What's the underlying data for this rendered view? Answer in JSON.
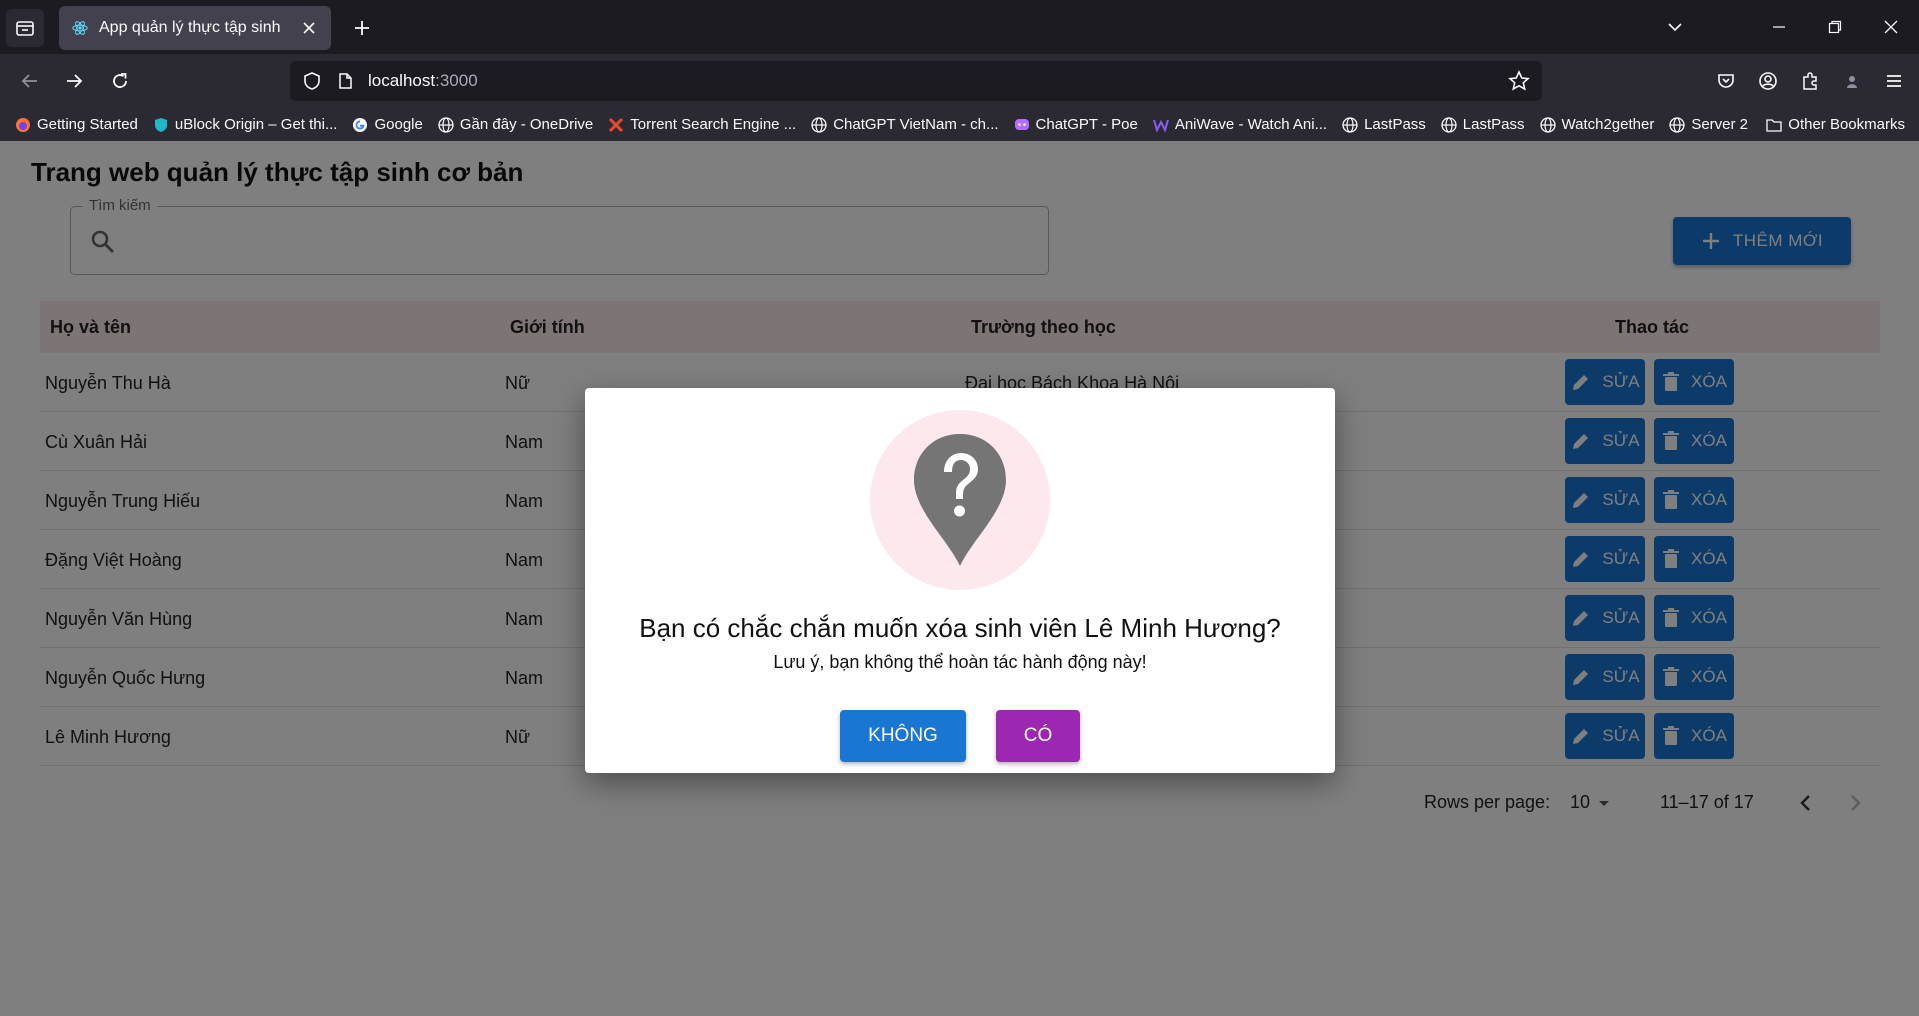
{
  "browser": {
    "tab_title": "App quản lý thực tập sinh",
    "url_host": "localhost",
    "url_port": ":3000",
    "bookmarks": [
      {
        "label": "Getting Started",
        "icon": "firefox-icon"
      },
      {
        "label": "uBlock Origin – Get thi...",
        "icon": "ublock-icon"
      },
      {
        "label": "Google",
        "icon": "google-icon"
      },
      {
        "label": "Gần đây - OneDrive",
        "icon": "globe-icon"
      },
      {
        "label": "Torrent Search Engine ...",
        "icon": "torrent-icon"
      },
      {
        "label": "ChatGPT VietNam - ch...",
        "icon": "globe-icon"
      },
      {
        "label": "ChatGPT - Poe",
        "icon": "poe-icon"
      },
      {
        "label": "AniWave - Watch Ani...",
        "icon": "aniwave-icon"
      },
      {
        "label": "LastPass",
        "icon": "globe-icon"
      },
      {
        "label": "LastPass",
        "icon": "globe-icon"
      },
      {
        "label": "Watch2gether",
        "icon": "globe-icon"
      },
      {
        "label": "Server 2",
        "icon": "globe-icon"
      }
    ],
    "other_bookmarks": "Other Bookmarks"
  },
  "page": {
    "title": "Trang web quản lý thực tập sinh cơ bản",
    "search_label": "Tìm kiếm",
    "search_value": "",
    "add_label": "THÊM MỚI",
    "columns": [
      "Họ và tên",
      "Giới tính",
      "Trường theo học",
      "Thao tác"
    ],
    "rows": [
      {
        "name": "Nguyễn Thu Hà",
        "gender": "Nữ",
        "school": "Đại học Bách Khoa Hà Nội"
      },
      {
        "name": "Cù Xuân Hải",
        "gender": "Nam",
        "school": ""
      },
      {
        "name": "Nguyễn Trung Hiếu",
        "gender": "Nam",
        "school": ""
      },
      {
        "name": "Đặng Việt Hoàng",
        "gender": "Nam",
        "school": ""
      },
      {
        "name": "Nguyễn Văn Hùng",
        "gender": "Nam",
        "school": ""
      },
      {
        "name": "Nguyễn Quốc Hưng",
        "gender": "Nam",
        "school": ""
      },
      {
        "name": "Lê Minh Hương",
        "gender": "Nữ",
        "school": ""
      }
    ],
    "edit_label": "SỬA",
    "delete_label": "XÓA",
    "rows_per_page_label": "Rows per page:",
    "rows_per_page_value": "10",
    "page_info": "11–17 of 17"
  },
  "dialog": {
    "title": "Bạn có chắc chắn muốn xóa sinh viên Lê Minh Hương?",
    "subtitle": "Lưu ý, bạn không thể hoàn tác hành động này!",
    "no_label": "KHÔNG",
    "yes_label": "CÓ"
  },
  "colors": {
    "primary": "#1976d2",
    "secondary": "#9c27b0",
    "table_header_bg": "#fbe9ea",
    "dialog_icon_bg": "#fde8ee",
    "dialog_icon": "#757575"
  }
}
